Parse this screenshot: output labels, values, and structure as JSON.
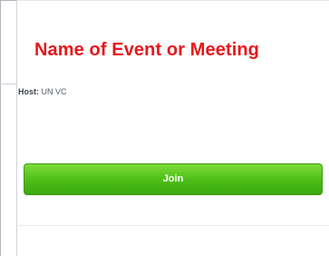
{
  "event": {
    "title": "Name of Event or Meeting"
  },
  "host": {
    "label": "Host:",
    "name": "UN VC"
  },
  "actions": {
    "join_label": "Join"
  },
  "colors": {
    "title": "#e8171c",
    "join_button": "#4fbf18"
  }
}
